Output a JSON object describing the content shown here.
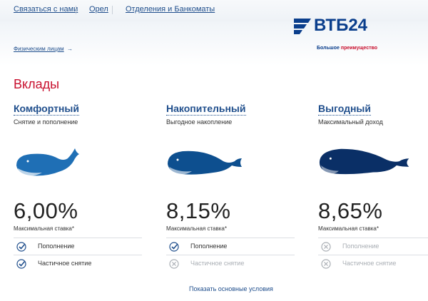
{
  "topnav": {
    "items": [
      "Связаться с нами",
      "Орел",
      "Отделения и Банкоматы"
    ]
  },
  "breadcrumb": {
    "label": "Физическим лицам",
    "arrow": "→"
  },
  "logo": {
    "text": "ВТБ",
    "number": "24",
    "slogan_prefix": "Большое",
    "slogan_highlight": "преимущество"
  },
  "page_title": "Вклады",
  "deposits": [
    {
      "name": "Комфортный",
      "description": "Снятие и пополнение",
      "rate": "6,00%",
      "rate_label": "Максимальная ставка*",
      "options": [
        {
          "label": "Пополнение",
          "enabled": true
        },
        {
          "label": "Частичное снятие",
          "enabled": true
        }
      ]
    },
    {
      "name": "Накопительный",
      "description": "Выгодное накопление",
      "rate": "8,15%",
      "rate_label": "Максимальная ставка*",
      "options": [
        {
          "label": "Пополнение",
          "enabled": true
        },
        {
          "label": "Частичное снятие",
          "enabled": false
        }
      ]
    },
    {
      "name": "Выгодный",
      "description": "Максимальный доход",
      "rate": "8,65%",
      "rate_label": "Максимальная ставка*",
      "options": [
        {
          "label": "Пополнение",
          "enabled": false
        },
        {
          "label": "Частичное снятие",
          "enabled": false
        }
      ]
    }
  ],
  "show_conditions": "Показать основные условия",
  "colors": {
    "brand_blue": "#0a3e8c",
    "accent_red": "#c8102e",
    "link_blue": "#1f4e8c",
    "check_blue": "#1f4e8c",
    "disabled_gray": "#a9aeb4"
  }
}
